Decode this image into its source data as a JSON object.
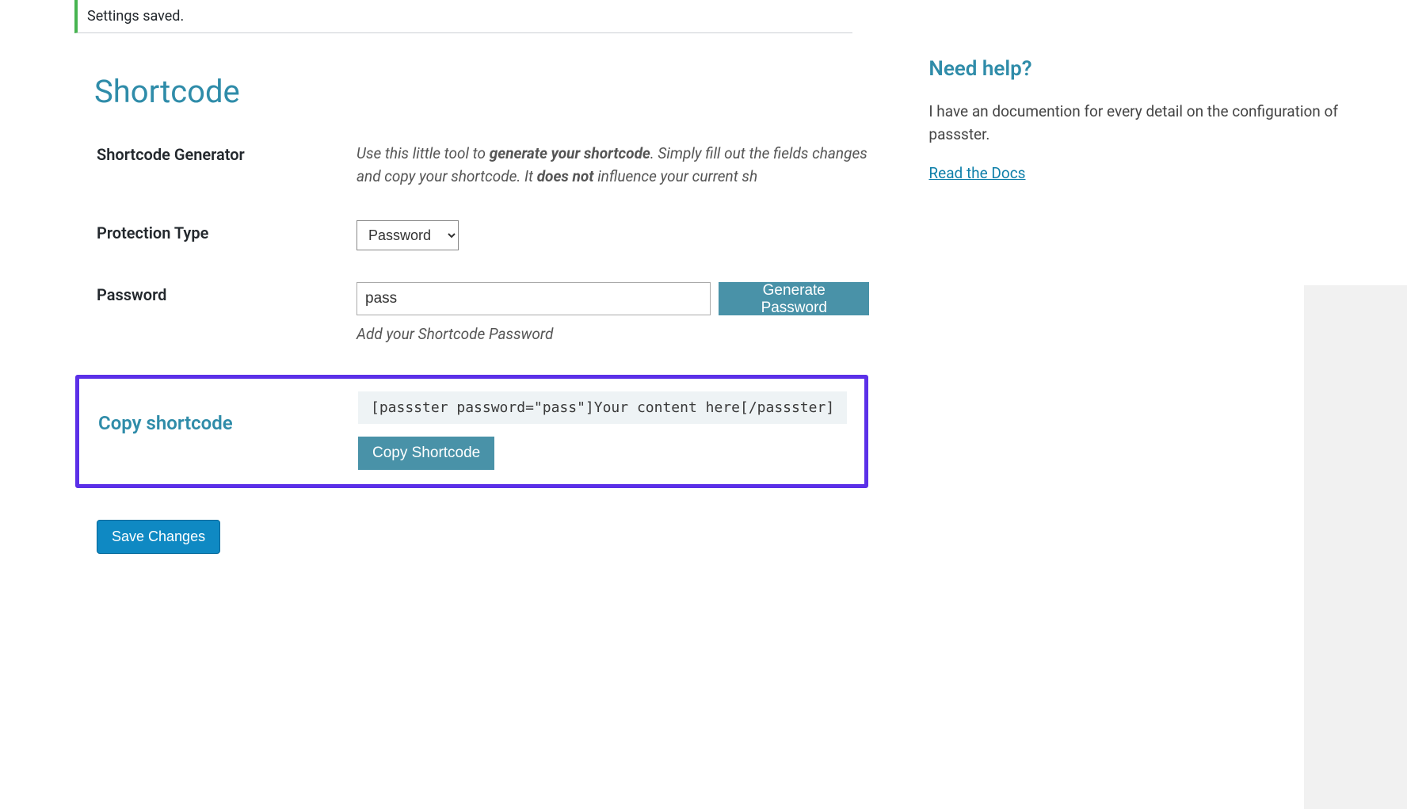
{
  "notice": {
    "message": "Settings saved."
  },
  "section": {
    "title": "Shortcode"
  },
  "rows": {
    "generator": {
      "label": "Shortcode Generator",
      "desc_part1": "Use this little tool to ",
      "desc_bold1": "generate your shortcode",
      "desc_part2": ". Simply fill out the fields changes and copy your shortcode. It ",
      "desc_bold2": "does not",
      "desc_part3": " influence your current sh"
    },
    "protection": {
      "label": "Protection Type",
      "selected": "Password"
    },
    "password": {
      "label": "Password",
      "value": "pass",
      "button": "Generate Password",
      "help": "Add your Shortcode Password"
    },
    "copy": {
      "label": "Copy shortcode",
      "output": "[passster password=\"pass\"]Your content here[/passster]",
      "button": "Copy Shortcode"
    }
  },
  "submit": {
    "save": "Save Changes"
  },
  "sidebar": {
    "heading": "Need help?",
    "text": "I have an documention for every detail on the configuration of passster.",
    "link": "Read the Docs"
  }
}
